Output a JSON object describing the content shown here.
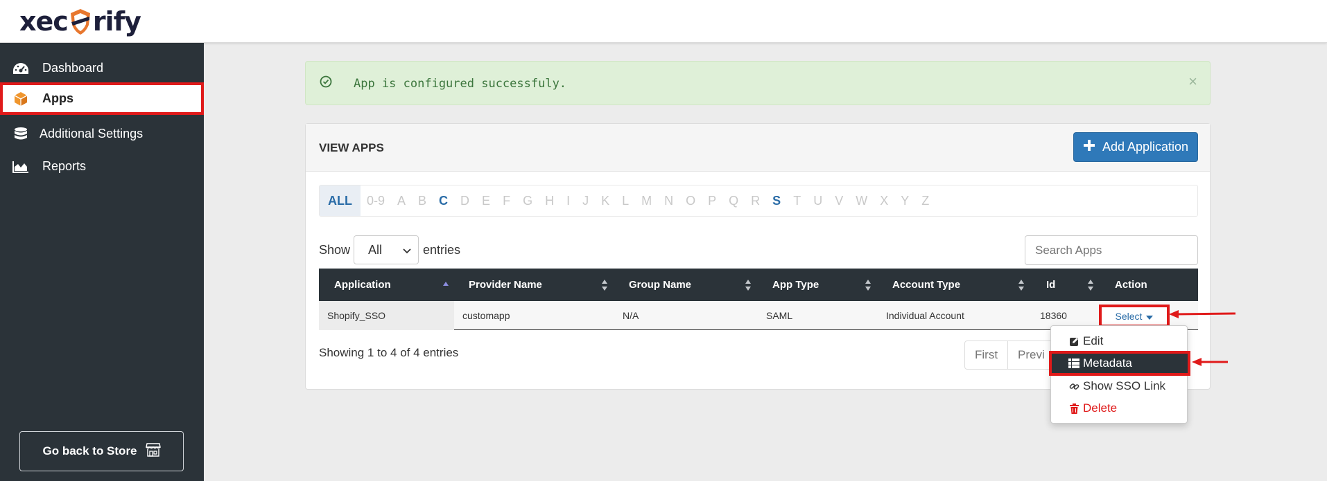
{
  "brand": {
    "logo_text_left": "xec",
    "logo_text_right": "rify"
  },
  "sidebar": {
    "items": [
      {
        "label": "Dashboard",
        "icon": "dashboard-icon"
      },
      {
        "label": "Apps",
        "icon": "cube-icon",
        "active": true
      },
      {
        "label": "Additional Settings",
        "icon": "database-icon"
      },
      {
        "label": "Reports",
        "icon": "area-chart-icon"
      }
    ],
    "store_button": "Go back to Store"
  },
  "alert": {
    "message": "App is configured successfuly.",
    "close": "×"
  },
  "panel": {
    "title": "VIEW APPS",
    "add_button": "Add Application",
    "alphabet": [
      "ALL",
      "0-9",
      "A",
      "B",
      "C",
      "D",
      "E",
      "F",
      "G",
      "H",
      "I",
      "J",
      "K",
      "L",
      "M",
      "N",
      "O",
      "P",
      "Q",
      "R",
      "S",
      "T",
      "U",
      "V",
      "W",
      "X",
      "Y",
      "Z"
    ],
    "alphabet_active": [
      "ALL",
      "C",
      "S"
    ],
    "show_label": "Show",
    "show_value": "All",
    "entries_label": "entries",
    "search_placeholder": "Search Apps"
  },
  "table": {
    "headers": [
      "Application",
      "Provider Name",
      "Group Name",
      "App Type",
      "Account Type",
      "Id",
      "Action"
    ],
    "rows": [
      {
        "application": "Shopify_SSO",
        "provider": "customapp",
        "group": "N/A",
        "app_type": "SAML",
        "account_type": "Individual Account",
        "id": "18360",
        "action": "Select"
      }
    ],
    "info": "Showing 1 to 4 of 4 entries",
    "pager": [
      "First",
      "Previ"
    ]
  },
  "dropdown": {
    "items": [
      {
        "label": "Edit",
        "icon": "edit-icon"
      },
      {
        "label": "Metadata",
        "icon": "list-icon",
        "highlighted": true
      },
      {
        "label": "Show SSO Link",
        "icon": "link-icon"
      },
      {
        "label": "Delete",
        "icon": "trash-icon",
        "danger": true
      }
    ]
  },
  "colors": {
    "sidebar_bg": "#2b3339",
    "accent": "#2f79b9",
    "highlight": "#e01a1a",
    "success_bg": "#dff0d8"
  }
}
